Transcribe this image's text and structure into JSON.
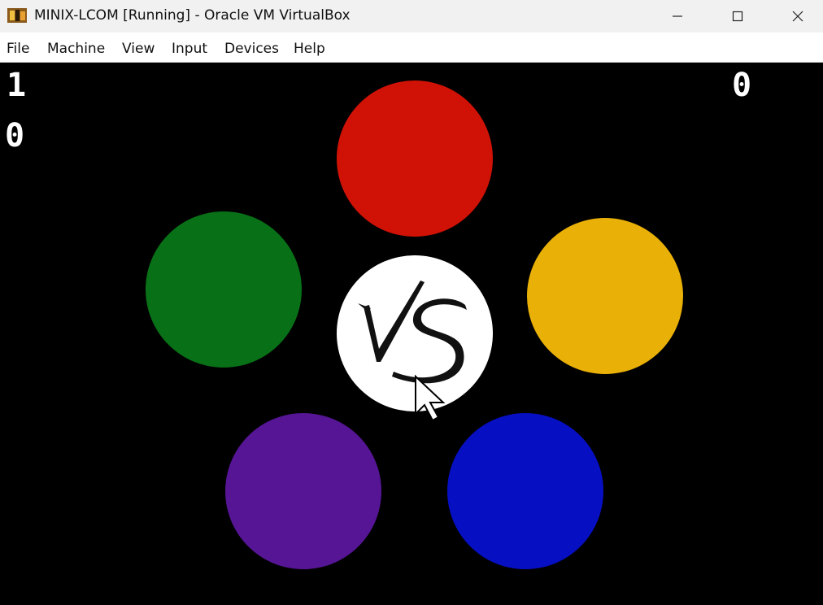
{
  "window": {
    "title": "MINIX-LCOM [Running] - Oracle VM VirtualBox",
    "controls": [
      "minimize",
      "maximize",
      "close"
    ]
  },
  "menu": {
    "items": [
      "File",
      "Machine",
      "View",
      "Input",
      "Devices",
      "Help"
    ]
  },
  "game": {
    "scores": {
      "left_top": "1",
      "left_bottom": "0",
      "right_top": "0"
    },
    "center_label": "VS",
    "buttons": [
      {
        "color_name": "red",
        "color": "#d01206"
      },
      {
        "color_name": "yellow",
        "color": "#e9b007"
      },
      {
        "color_name": "blue",
        "color": "#0610c2"
      },
      {
        "color_name": "purple",
        "color": "#551594"
      },
      {
        "color_name": "green",
        "color": "#087016"
      }
    ],
    "center_color": "#ffffff"
  }
}
